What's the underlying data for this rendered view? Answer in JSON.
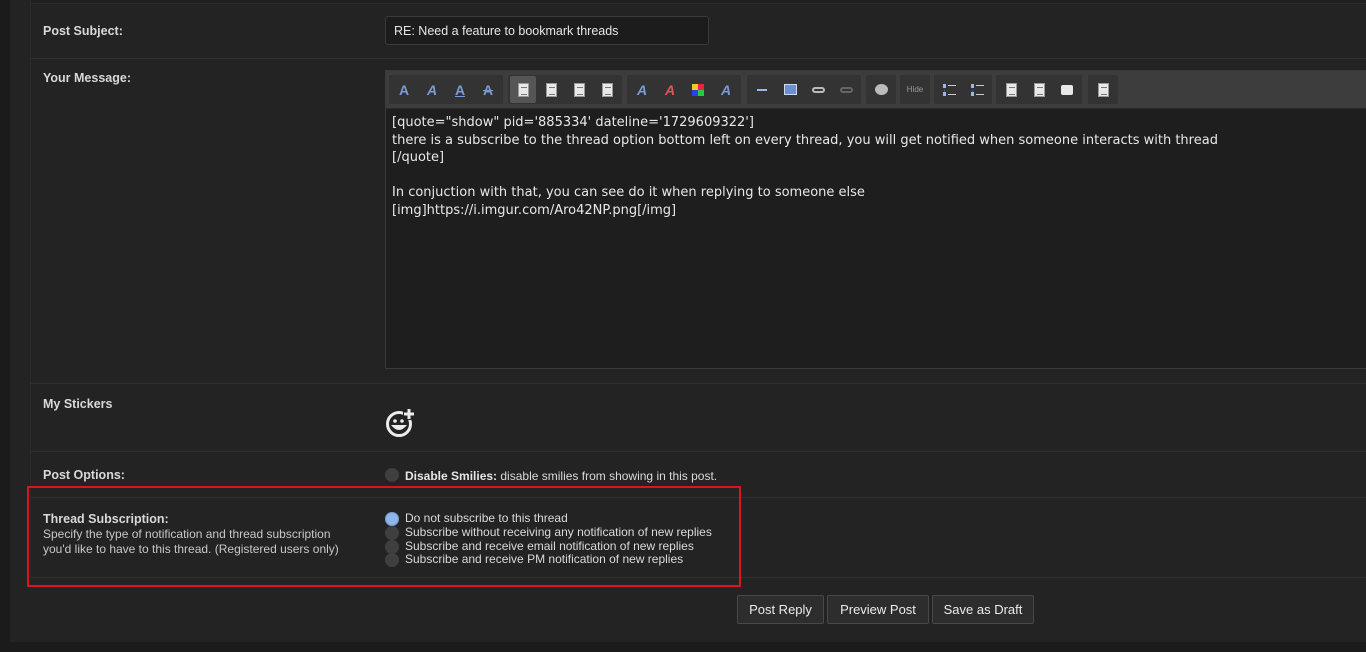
{
  "form": {
    "subject": {
      "label": "Post Subject:",
      "value": "RE: Need a feature to bookmark threads"
    },
    "message": {
      "label": "Your Message:",
      "text": "[quote=\"shdow\" pid='885334' dateline='1729609322']\nthere is a subscribe to the thread option bottom left on every thread, you will get notified when someone interacts with thread\n[/quote]\n\nIn conjuction with that, you can see do it when replying to someone else\n[img]https://i.imgur.com/Aro42NP.png[/img]"
    },
    "toolbar": {
      "buttons": [
        {
          "name": "bold",
          "icon": "bold-icon"
        },
        {
          "name": "italic",
          "icon": "italic-icon"
        },
        {
          "name": "underline",
          "icon": "underline-icon"
        },
        {
          "name": "strikethrough",
          "icon": "strikethrough-icon"
        },
        {
          "name": "align-left",
          "icon": "align-left-icon"
        },
        {
          "name": "align-center",
          "icon": "align-center-icon"
        },
        {
          "name": "align-right",
          "icon": "align-right-icon"
        },
        {
          "name": "justify",
          "icon": "justify-icon"
        },
        {
          "name": "font",
          "icon": "font-icon"
        },
        {
          "name": "size",
          "icon": "font-size-icon"
        },
        {
          "name": "color",
          "icon": "color-grid-icon"
        },
        {
          "name": "remove-format",
          "icon": "remove-format-icon"
        },
        {
          "name": "horizontal-rule",
          "icon": "horizontal-rule-icon"
        },
        {
          "name": "image",
          "icon": "image-icon"
        },
        {
          "name": "link",
          "icon": "link-icon"
        },
        {
          "name": "unlink",
          "icon": "unlink-icon"
        },
        {
          "name": "video",
          "icon": "video-icon"
        },
        {
          "name": "hide",
          "icon": "hide-icon",
          "label": "Hide"
        },
        {
          "name": "bullet-list",
          "icon": "bullet-list-icon"
        },
        {
          "name": "ordered-list",
          "icon": "ordered-list-icon"
        },
        {
          "name": "code",
          "icon": "code-icon"
        },
        {
          "name": "php",
          "icon": "php-icon"
        },
        {
          "name": "quote",
          "icon": "quote-icon"
        },
        {
          "name": "source",
          "icon": "source-icon"
        }
      ]
    },
    "stickers": {
      "label": "My Stickers",
      "icon": "add-sticker-icon"
    },
    "post_options": {
      "label": "Post Options:",
      "disable_smilies_bold": "Disable Smilies:",
      "disable_smilies_text": " disable smilies from showing in this post."
    },
    "subscription": {
      "label": "Thread Subscription:",
      "description": "Specify the type of notification and thread subscription you'd like to have to this thread. (Registered users only)",
      "options": [
        {
          "label": "Do not subscribe to this thread",
          "checked": true
        },
        {
          "label": "Subscribe without receiving any notification of new replies",
          "checked": false
        },
        {
          "label": "Subscribe and receive email notification of new replies",
          "checked": false
        },
        {
          "label": "Subscribe and receive PM notification of new replies",
          "checked": false
        }
      ]
    },
    "actions": {
      "post_reply": "Post Reply",
      "preview_post": "Preview Post",
      "save_draft": "Save as Draft"
    }
  },
  "colors": {
    "background": "#1b1b1b",
    "panel": "#232323",
    "accent_radio": "#8fb6e8",
    "highlight_border": "#d9161b"
  }
}
